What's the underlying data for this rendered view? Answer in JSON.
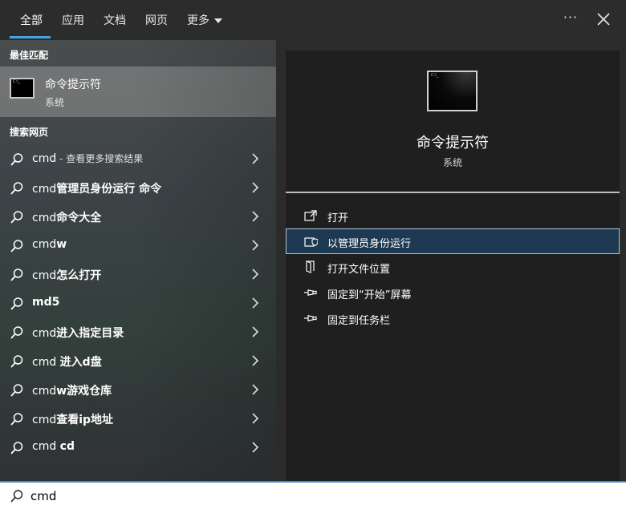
{
  "tabs": [
    {
      "label": "全部",
      "active": true
    },
    {
      "label": "应用",
      "active": false
    },
    {
      "label": "文档",
      "active": false
    },
    {
      "label": "网页",
      "active": false
    },
    {
      "label": "更多",
      "active": false
    }
  ],
  "header_icons": {
    "more": "more-options-icon",
    "close": "close-icon"
  },
  "accent_color": "#4aa3e6",
  "left": {
    "best_match_heading": "最佳匹配",
    "best_match": {
      "title": "命令提示符",
      "subtitle": "系统",
      "icon": "command-prompt-icon"
    },
    "web_heading": "搜索网页",
    "web_items": [
      {
        "prefix": "cmd",
        "bold": "",
        "suffix": " - 查看更多搜索结果"
      },
      {
        "prefix": "cmd",
        "bold": "管理员身份运行 命令",
        "suffix": ""
      },
      {
        "prefix": "cmd",
        "bold": "命令大全",
        "suffix": ""
      },
      {
        "prefix": "cmd",
        "bold": "w",
        "suffix": ""
      },
      {
        "prefix": "cmd",
        "bold": "怎么打开",
        "suffix": ""
      },
      {
        "prefix": "",
        "bold": "md5",
        "suffix": ""
      },
      {
        "prefix": "cmd",
        "bold": "进入指定目录",
        "suffix": ""
      },
      {
        "prefix": "cmd ",
        "bold": "进入d盘",
        "suffix": ""
      },
      {
        "prefix": "cmd",
        "bold": "w游戏仓库",
        "suffix": ""
      },
      {
        "prefix": "cmd",
        "bold": "查看ip地址",
        "suffix": ""
      },
      {
        "prefix": "cmd ",
        "bold": "cd",
        "suffix": ""
      }
    ]
  },
  "detail": {
    "title": "命令提示符",
    "subtitle": "系统",
    "actions": [
      {
        "label": "打开",
        "icon": "open-icon",
        "selected": false
      },
      {
        "label": "以管理员身份运行",
        "icon": "shield-icon",
        "selected": true
      },
      {
        "label": "打开文件位置",
        "icon": "file-location-icon",
        "selected": false
      },
      {
        "label": "固定到“开始”屏幕",
        "icon": "pin-icon",
        "selected": false
      },
      {
        "label": "固定到任务栏",
        "icon": "pin-icon",
        "selected": false
      }
    ]
  },
  "search": {
    "value": "cmd",
    "icon": "search-icon"
  }
}
